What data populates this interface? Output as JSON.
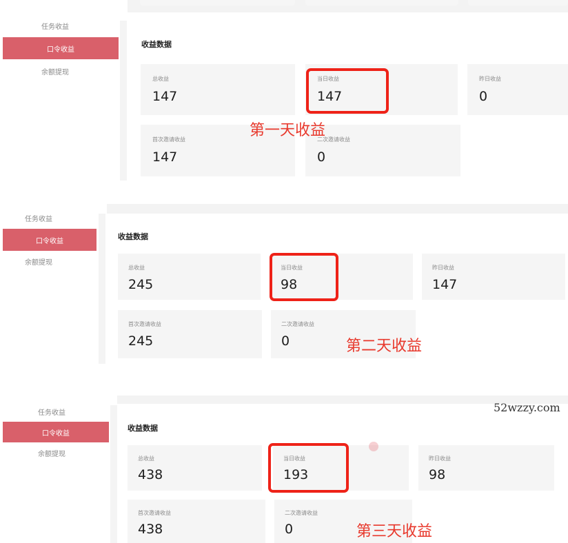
{
  "watermark": "52wzzy.com",
  "colors": {
    "accent": "#d9606a",
    "highlight": "#ee2218",
    "annotation": "#e8382c"
  },
  "panels": [
    {
      "sidebar": [
        {
          "label": "任务收益",
          "active": false
        },
        {
          "label": "口令收益",
          "active": true
        },
        {
          "label": "余额提现",
          "active": false
        }
      ],
      "section_title": "收益数据",
      "cards": [
        {
          "label": "总收益",
          "value": "147"
        },
        {
          "label": "当日收益",
          "value": "147"
        },
        {
          "label": "昨日收益",
          "value": "0"
        },
        {
          "label": "首次邀请收益",
          "value": "147"
        },
        {
          "label": "二次邀请收益",
          "value": "0"
        }
      ],
      "annotation": "第一天收益"
    },
    {
      "sidebar": [
        {
          "label": "任务收益",
          "active": false
        },
        {
          "label": "口令收益",
          "active": true
        },
        {
          "label": "余额提现",
          "active": false
        }
      ],
      "section_title": "收益数据",
      "cards": [
        {
          "label": "总收益",
          "value": "245"
        },
        {
          "label": "当日收益",
          "value": "98"
        },
        {
          "label": "昨日收益",
          "value": "147"
        },
        {
          "label": "首次邀请收益",
          "value": "245"
        },
        {
          "label": "二次邀请收益",
          "value": "0"
        }
      ],
      "annotation": "第二天收益"
    },
    {
      "sidebar": [
        {
          "label": "任务收益",
          "active": false
        },
        {
          "label": "口令收益",
          "active": true
        },
        {
          "label": "余额提现",
          "active": false
        }
      ],
      "section_title": "收益数据",
      "cards": [
        {
          "label": "总收益",
          "value": "438"
        },
        {
          "label": "当日收益",
          "value": "193"
        },
        {
          "label": "昨日收益",
          "value": "98"
        },
        {
          "label": "首次邀请收益",
          "value": "438"
        },
        {
          "label": "二次邀请收益",
          "value": "0"
        }
      ],
      "annotation": "第三天收益"
    }
  ]
}
